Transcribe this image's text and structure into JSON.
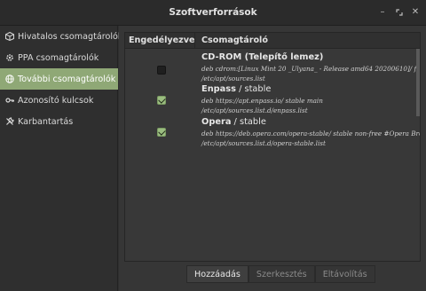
{
  "window": {
    "title": "Szoftverforrások",
    "minimize_icon": "minimize-icon",
    "maximize_icon": "maximize-icon",
    "close_icon": "close-icon"
  },
  "sidebar": {
    "items": [
      {
        "label": "Hivatalos csomagtárolók",
        "icon": "package-icon",
        "active": false
      },
      {
        "label": "PPA csomagtárolók",
        "icon": "gear-icon",
        "active": false
      },
      {
        "label": "További csomagtárolók",
        "icon": "globe-icon",
        "active": true
      },
      {
        "label": "Azonosító kulcsok",
        "icon": "key-icon",
        "active": false
      },
      {
        "label": "Karbantartás",
        "icon": "tools-icon",
        "active": false
      }
    ]
  },
  "table": {
    "headers": {
      "enabled": "Engedélyezve",
      "repository": "Csomagtároló"
    },
    "rows": [
      {
        "enabled": false,
        "name": "CD-ROM (Telepítő lemez)",
        "suffix": "",
        "line1": "deb cdrom:[Linux Mint 20 _Ulyana_ - Release amd64 20200610]/ focal",
        "line2": "/etc/apt/sources.list"
      },
      {
        "enabled": true,
        "name": "Enpass",
        "suffix": " / stable",
        "line1": "deb https://apt.enpass.io/ stable main",
        "line2": "/etc/apt/sources.list.d/enpass.list"
      },
      {
        "enabled": true,
        "name": "Opera",
        "suffix": " / stable",
        "line1": "deb https://deb.opera.com/opera-stable/ stable non-free #Opera Brows",
        "line2": "/etc/apt/sources.list.d/opera-stable.list"
      }
    ]
  },
  "toolbar": {
    "add_label": "Hozzáadás",
    "edit_label": "Szerkesztés",
    "remove_label": "Eltávolítás"
  },
  "colors": {
    "accent": "#8fa876",
    "checkbox_on": "#9bbd80"
  }
}
